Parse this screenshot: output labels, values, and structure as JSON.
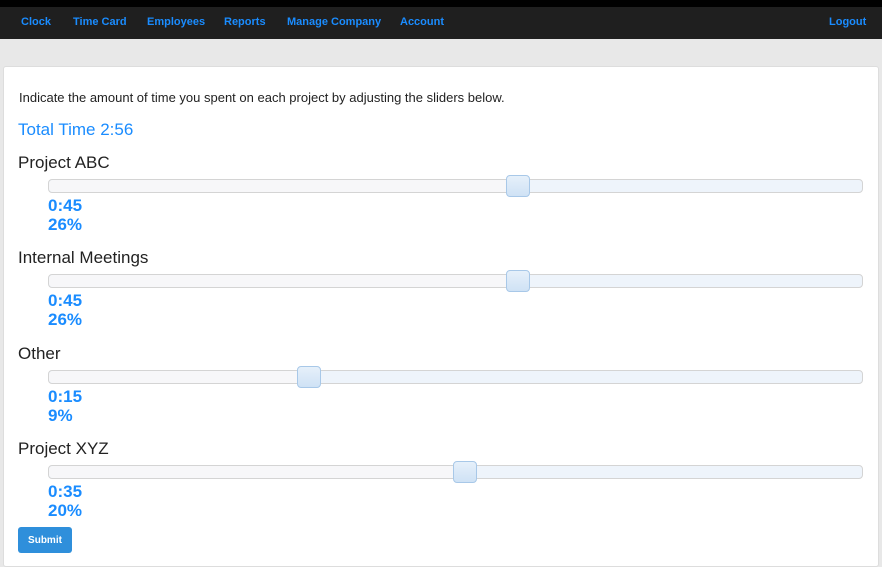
{
  "nav": {
    "items": [
      "Clock",
      "Time Card",
      "Employees",
      "Reports",
      "Manage Company",
      "Account"
    ],
    "logout": "Logout"
  },
  "intro": "Indicate the amount of time you spent on each project by adjusting the sliders below.",
  "total": "Total Time 2:56",
  "projects": [
    {
      "name": "Project ABC",
      "time": "0:45",
      "percent": "26%",
      "slider_position": 0.577
    },
    {
      "name": "Internal Meetings",
      "time": "0:45",
      "percent": "26%",
      "slider_position": 0.577
    },
    {
      "name": "Other",
      "time": "0:15",
      "percent": "9%",
      "slider_position": 0.32
    },
    {
      "name": "Project XYZ",
      "time": "0:35",
      "percent": "20%",
      "slider_position": 0.512
    }
  ],
  "submit": "Submit"
}
